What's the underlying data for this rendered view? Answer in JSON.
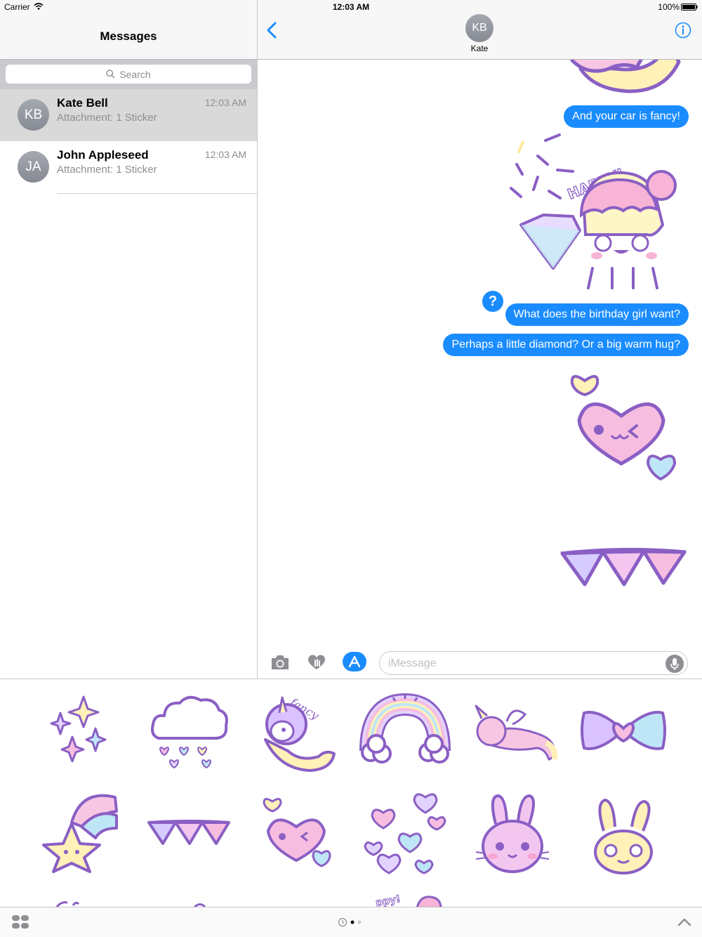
{
  "status_bar": {
    "carrier": "Carrier",
    "time": "12:03 AM",
    "battery": "100%"
  },
  "sidebar": {
    "title": "Messages",
    "search_placeholder": "Search",
    "conversations": [
      {
        "initials": "KB",
        "name": "Kate Bell",
        "preview": "Attachment: 1 Sticker",
        "time": "12:03 AM",
        "selected": true
      },
      {
        "initials": "JA",
        "name": "John Appleseed",
        "preview": "Attachment: 1 Sticker",
        "time": "12:03 AM",
        "selected": false
      }
    ]
  },
  "conversation": {
    "contact_initials": "KB",
    "contact_name": "Kate",
    "messages": [
      {
        "text": "And your car is fancy!"
      },
      {
        "text": "What does the birthday girl want?"
      },
      {
        "text": "Perhaps a little diamond? Or a big warm hug?"
      }
    ],
    "tapback": "?",
    "sticker_text": "HAPPY!"
  },
  "compose": {
    "placeholder": "iMessage"
  },
  "drawer": {
    "stickers": [
      "sparkles",
      "cloud-hearts",
      "unicorn-moon",
      "rainbow",
      "flying-unicorn",
      "bow",
      "shooting-star",
      "bunting",
      "wink-heart",
      "hearts",
      "pink-bunny",
      "yellow-bunny"
    ],
    "sticker_text": "fancy",
    "partial_text": "ppy!"
  },
  "colors": {
    "accent": "#1a8cff",
    "lilac": "#8a5fc4",
    "pink": "#f7c6e2",
    "yellow": "#fff1b8",
    "blue": "#bfe6f7"
  }
}
